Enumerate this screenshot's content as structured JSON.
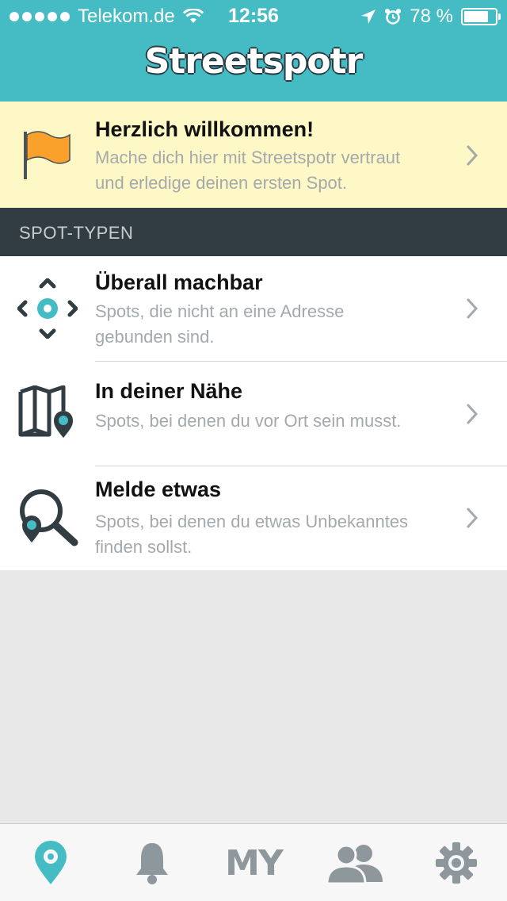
{
  "status_bar": {
    "carrier": "Telekom.de",
    "time": "12:56",
    "battery": "78 %",
    "battery_level": 0.78
  },
  "header": {
    "app_title": "Streetspotr"
  },
  "welcome": {
    "title": "Herzlich willkommen!",
    "line1": "Mache dich hier mit Streetspotr vertraut",
    "line2": "und erledige deinen ersten Spot."
  },
  "section": {
    "title": "SPOT-TYPEN"
  },
  "spot_types": [
    {
      "title": "Überall machbar",
      "line1": "Spots, die nicht an eine Adresse",
      "line2": "gebunden sind."
    },
    {
      "title": "In deiner Nähe",
      "line1": "Spots, bei denen du vor Ort sein musst.",
      "line2": ""
    },
    {
      "title": "Melde etwas",
      "line1": "Spots, bei denen du etwas Unbekanntes",
      "line2": "finden sollst."
    }
  ],
  "tabbar": {
    "my_label": "MY",
    "icons": [
      "location-pin-icon",
      "bell-icon",
      "my-icon",
      "friends-icon",
      "gear-icon"
    ],
    "active_color": "#45bcc4",
    "inactive_color": "#8d979c"
  },
  "colors": {
    "accent": "#45bcc4",
    "banner_bg": "#fdf8c5",
    "flag": "#f9a12b",
    "section_bg": "#313c43"
  }
}
